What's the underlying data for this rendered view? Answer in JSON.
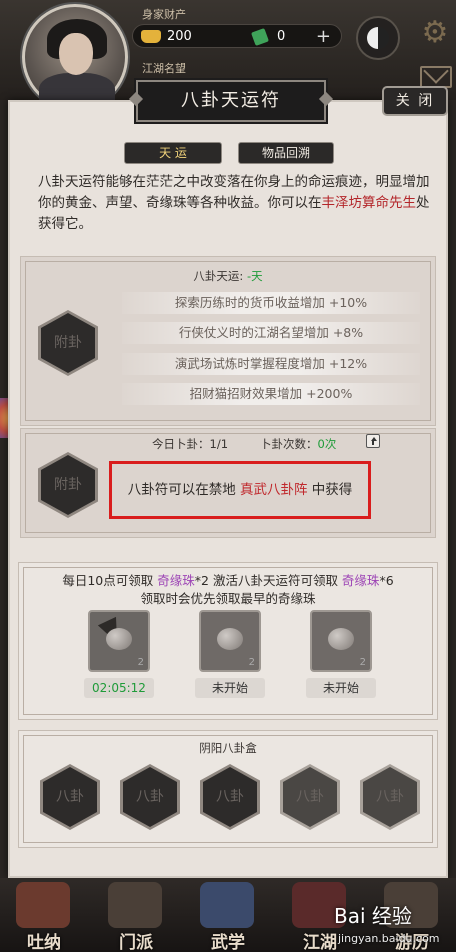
{
  "hud": {
    "assets_label": "身家财产",
    "gold": "200",
    "jade": "0",
    "reputation_label": "江湖名望"
  },
  "dialog": {
    "title": "八卦天运符",
    "close": "关 闭",
    "tabs": [
      {
        "label": "天 运",
        "active": true
      },
      {
        "label": "物品回溯",
        "active": false
      }
    ],
    "desc_1": "八卦天运符能够在茫茫之中改变落在你身上的命运痕迹，明显增加你的黄金、声望、奇缘珠等各种收益。你可以在",
    "desc_red": "丰泽坊算命先生",
    "desc_2": "处获得它。"
  },
  "fortune": {
    "label": "八卦天运:",
    "value": "-天",
    "hex_label": "附卦",
    "effects": [
      "探索历练时的货币收益增加 +10%",
      "行侠仗义时的江湖名望增加 +8%",
      "演武场试炼时掌握程度增加 +12%",
      "招财猫招财效果增加 +200%"
    ]
  },
  "divination": {
    "today_label": "今日卜卦：",
    "today_value": "1/1",
    "count_label": "卜卦次数：",
    "count_value": "0次",
    "hex_label": "附卦",
    "notice_1": "八卦符可以在禁地 ",
    "notice_red": "真武八卦阵",
    "notice_2": " 中获得"
  },
  "daily": {
    "line1_a": "每日10点可领取 ",
    "line1_b": "奇缘珠",
    "line1_c": "*2 激活八卦天运符可领取 ",
    "line1_d": "奇缘珠",
    "line1_e": "*6",
    "line2": "领取时会优先领取最早的奇缘珠",
    "slots": [
      {
        "count": "2",
        "status": "02:05:12"
      },
      {
        "count": "2",
        "status": "未开始"
      },
      {
        "count": "2",
        "status": "未开始"
      }
    ]
  },
  "yinyang_box": {
    "title": "阴阳八卦盒",
    "items": [
      "八卦",
      "八卦",
      "八卦",
      "八卦",
      "八卦"
    ]
  },
  "nav": [
    {
      "label": "吐纳"
    },
    {
      "label": "门派"
    },
    {
      "label": "武学"
    },
    {
      "label": "江湖"
    },
    {
      "label": "游历"
    }
  ],
  "watermark": {
    "brand": "Bai 经验",
    "url": "jingyan.baidu.com"
  },
  "colors": {
    "accent_red": "#c0282c",
    "accent_green": "#1f9b39",
    "accent_purple": "#9c43b5"
  }
}
